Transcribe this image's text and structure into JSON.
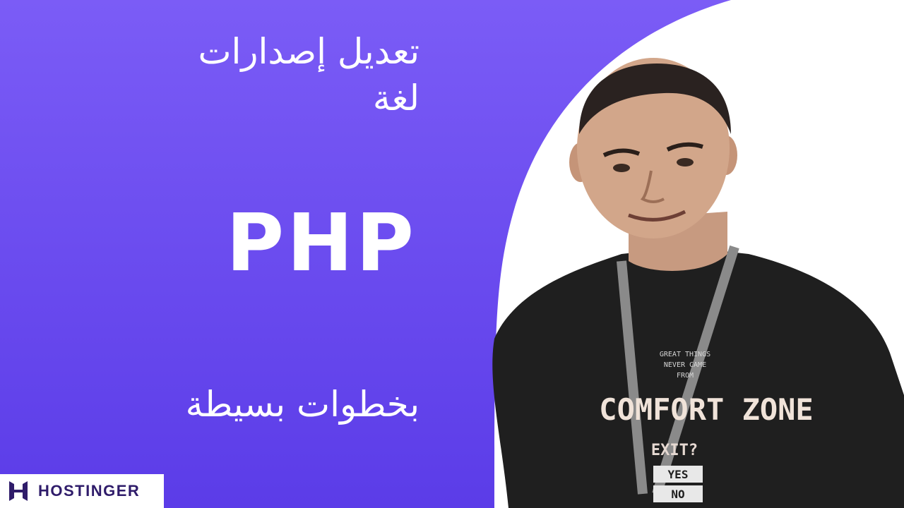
{
  "headline": {
    "line1": "تعديل إصدارات",
    "line2": "لغة",
    "language": "PHP",
    "subtitle": "بخطوات بسيطة"
  },
  "shirt": {
    "small_text_1": "GREAT THINGS",
    "small_text_2": "NEVER CAME",
    "small_text_3": "FROM",
    "main_text": "COMFORT ZONE",
    "question": "EXIT?",
    "option_yes": "YES",
    "option_no": "NO"
  },
  "brand": {
    "name": "HOSTINGER",
    "logo_icon": "hostinger-h-logo"
  },
  "colors": {
    "purple_top": "#7a5af5",
    "purple_bottom": "#5a3be8",
    "brand_text": "#2f1c6a",
    "shirt": "#1f1f1f"
  }
}
